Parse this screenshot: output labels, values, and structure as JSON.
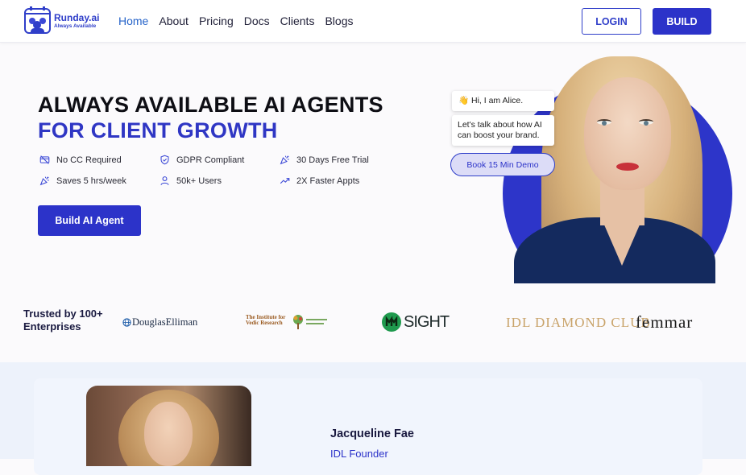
{
  "nav": {
    "logo_name": "Runday.ai",
    "logo_tagline": "Always Available",
    "items": [
      {
        "label": "Home",
        "active": true
      },
      {
        "label": "About"
      },
      {
        "label": "Pricing"
      },
      {
        "label": "Docs"
      },
      {
        "label": "Clients"
      },
      {
        "label": "Blogs"
      }
    ],
    "login_label": "LOGIN",
    "build_label": "BUILD"
  },
  "hero": {
    "headline_line1": "ALWAYS AVAILABLE AI AGENTS",
    "headline_line2": "FOR CLIENT GROWTH",
    "features": [
      {
        "label": "No CC Required",
        "icon": "credit-card-off-icon"
      },
      {
        "label": "GDPR Compliant",
        "icon": "shield-check-icon"
      },
      {
        "label": "30 Days Free Trial",
        "icon": "party-popper-icon"
      },
      {
        "label": "Saves 5 hrs/week",
        "icon": "party-popper-icon"
      },
      {
        "label": "50k+ Users",
        "icon": "user-icon"
      },
      {
        "label": "2X Faster Appts",
        "icon": "trending-up-icon"
      }
    ],
    "cta_label": "Build AI Agent",
    "chat": {
      "greeting": "👋 Hi, I am Alice.",
      "message": "Let's talk about how AI can boost your brand.",
      "demo_label": "Book 15 Min Demo"
    }
  },
  "trusted": {
    "title_line1": "Trusted by 100+",
    "title_line2": "Enterprises",
    "brands": [
      "DouglasElliman",
      "The Institute for Vedic Research",
      "SIGHT",
      "IDL DIAMOND CLUB",
      "femmar"
    ]
  },
  "testimonial": {
    "name": "Jacqueline Fae",
    "role": "IDL Founder"
  },
  "colors": {
    "accent": "#2c33c9",
    "nav_active": "#2563c9",
    "section_bg": "#edf2fb"
  }
}
